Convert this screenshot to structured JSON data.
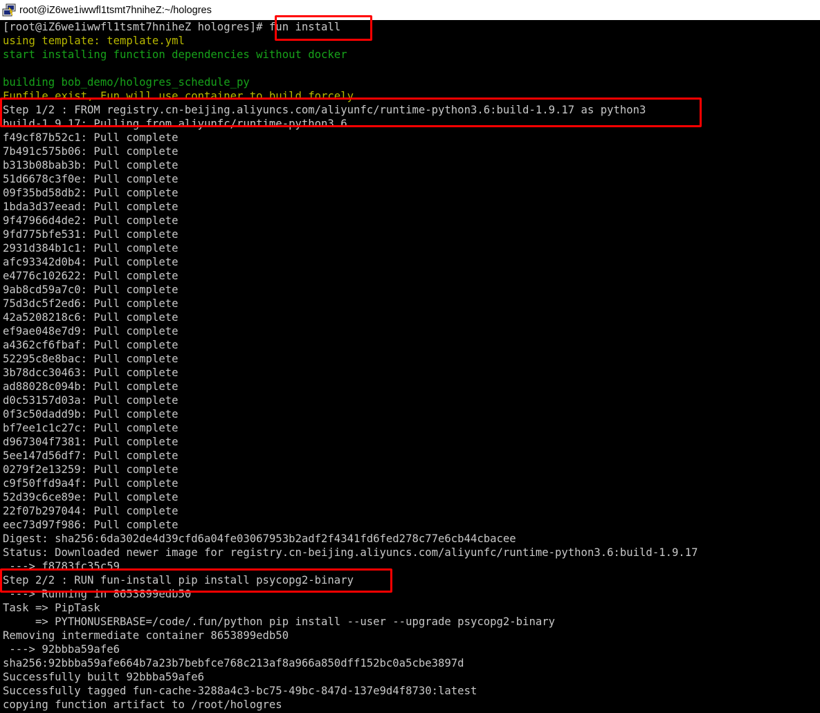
{
  "window": {
    "title": "root@iZ6we1iwwfl1tsmt7hniheZ:~/hologres",
    "icon": "putty-terminal-icon"
  },
  "terminal": {
    "colors": {
      "background": "#000000",
      "text": "#c8c8c8",
      "yellow": "#b8b800",
      "green": "#17a21a",
      "highlight": "#ff0000"
    },
    "lines": [
      {
        "text": "[root@iZ6we1iwwfl1tsmt7hniheZ hologres]# fun install",
        "color": "white"
      },
      {
        "text": "using template: template.yml",
        "color": "yellow"
      },
      {
        "text": "start installing function dependencies without docker",
        "color": "green"
      },
      {
        "text": "",
        "color": "white"
      },
      {
        "text": "building bob_demo/hologres_schedule_py",
        "color": "green"
      },
      {
        "text": "Funfile exist, Fun will use container to build forcely",
        "color": "yellow"
      },
      {
        "text": "Step 1/2 : FROM registry.cn-beijing.aliyuncs.com/aliyunfc/runtime-python3.6:build-1.9.17 as python3",
        "color": "white"
      },
      {
        "text": "build-1.9.17: Pulling from aliyunfc/runtime-python3.6",
        "color": "white"
      },
      {
        "text": "f49cf87b52c1: Pull complete",
        "color": "white"
      },
      {
        "text": "7b491c575b06: Pull complete",
        "color": "white"
      },
      {
        "text": "b313b08bab3b: Pull complete",
        "color": "white"
      },
      {
        "text": "51d6678c3f0e: Pull complete",
        "color": "white"
      },
      {
        "text": "09f35bd58db2: Pull complete",
        "color": "white"
      },
      {
        "text": "1bda3d37eead: Pull complete",
        "color": "white"
      },
      {
        "text": "9f47966d4de2: Pull complete",
        "color": "white"
      },
      {
        "text": "9fd775bfe531: Pull complete",
        "color": "white"
      },
      {
        "text": "2931d384b1c1: Pull complete",
        "color": "white"
      },
      {
        "text": "afc93342d0b4: Pull complete",
        "color": "white"
      },
      {
        "text": "e4776c102622: Pull complete",
        "color": "white"
      },
      {
        "text": "9ab8cd59a7c0: Pull complete",
        "color": "white"
      },
      {
        "text": "75d3dc5f2ed6: Pull complete",
        "color": "white"
      },
      {
        "text": "42a5208218c6: Pull complete",
        "color": "white"
      },
      {
        "text": "ef9ae048e7d9: Pull complete",
        "color": "white"
      },
      {
        "text": "a4362cf6fbaf: Pull complete",
        "color": "white"
      },
      {
        "text": "52295c8e8bac: Pull complete",
        "color": "white"
      },
      {
        "text": "3b78dcc30463: Pull complete",
        "color": "white"
      },
      {
        "text": "ad88028c094b: Pull complete",
        "color": "white"
      },
      {
        "text": "d0c53157d03a: Pull complete",
        "color": "white"
      },
      {
        "text": "0f3c50dadd9b: Pull complete",
        "color": "white"
      },
      {
        "text": "bf7ee1c1c27c: Pull complete",
        "color": "white"
      },
      {
        "text": "d967304f7381: Pull complete",
        "color": "white"
      },
      {
        "text": "5ee147d56df7: Pull complete",
        "color": "white"
      },
      {
        "text": "0279f2e13259: Pull complete",
        "color": "white"
      },
      {
        "text": "c9f50ffd9a4f: Pull complete",
        "color": "white"
      },
      {
        "text": "52d39c6ce89e: Pull complete",
        "color": "white"
      },
      {
        "text": "22f07b297044: Pull complete",
        "color": "white"
      },
      {
        "text": "eec73d97f986: Pull complete",
        "color": "white"
      },
      {
        "text": "Digest: sha256:6da302de4d39cfd6a04fe03067953b2adf2f4341fd6fed278c77e6cb44cbacee",
        "color": "white"
      },
      {
        "text": "Status: Downloaded newer image for registry.cn-beijing.aliyuncs.com/aliyunfc/runtime-python3.6:build-1.9.17",
        "color": "white"
      },
      {
        "text": " ---> f8783fc35c59",
        "color": "white"
      },
      {
        "text": "Step 2/2 : RUN fun-install pip install psycopg2-binary",
        "color": "white"
      },
      {
        "text": " ---> Running in 8653899edb50",
        "color": "white"
      },
      {
        "text": "Task => PipTask",
        "color": "white"
      },
      {
        "text": "     => PYTHONUSERBASE=/code/.fun/python pip install --user --upgrade psycopg2-binary",
        "color": "white"
      },
      {
        "text": "Removing intermediate container 8653899edb50",
        "color": "white"
      },
      {
        "text": " ---> 92bbba59afe6",
        "color": "white"
      },
      {
        "text": "sha256:92bbba59afe664b7a23b7bebfce768c213af8a966a850dff152bc0a5cbe3897d",
        "color": "white"
      },
      {
        "text": "Successfully built 92bbba59afe6",
        "color": "white"
      },
      {
        "text": "Successfully tagged fun-cache-3288a4c3-bc75-49bc-847d-137e9d4f8730:latest",
        "color": "white"
      },
      {
        "text": "copying function artifact to /root/hologres",
        "color": "white"
      }
    ]
  }
}
